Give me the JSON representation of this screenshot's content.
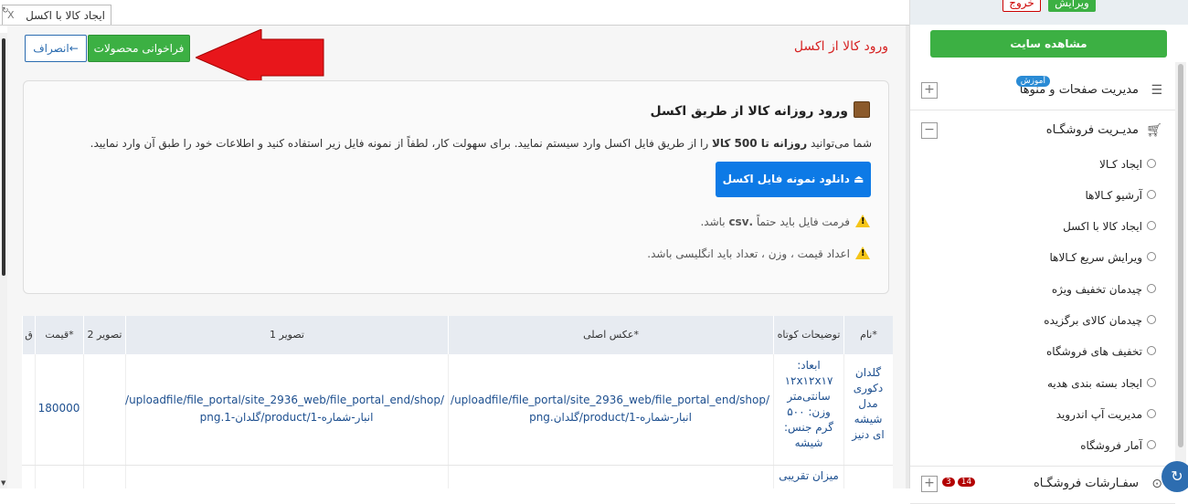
{
  "tab": {
    "title": "ایجاد کالا با اکسل",
    "close": "X"
  },
  "header": {
    "title": "ورود کالا از اکسل",
    "cancel_label": "انصراف←",
    "fetch_label": "فراخوانی محصولات"
  },
  "panel": {
    "title": "ورود روزانه کالا از طریق اکسل",
    "desc_prefix": "شما می‌توانید ",
    "desc_bold1": "روزانه تا 500 کالا",
    "desc_suffix": " را از طریق فایل اکسل وارد سیستم نمایید. برای سهولت کار، لطفاً از نمونه فایل زیر استفاده کنید و اطلاعات خود را طبق آن وارد نمایید.",
    "download_label": "دانلود نمونه فایل اکسل",
    "note1_prefix": "فرمت فایل باید حتماً ",
    "note1_bold": ".csv",
    "note1_suffix": " باشد.",
    "note2": "اعداد قیمت ، وزن ، تعداد باید انگلیسی باشد."
  },
  "table": {
    "headers": [
      "نام*",
      "توضیحات کوتاه",
      "عکس اصلی*",
      "تصویر 1",
      "تصویر 2",
      "قیمت*",
      "ق"
    ],
    "row1": {
      "name": "گلدان دکوری مدل شیشه ای دنیز",
      "desc": "ابعاد: ۱۲x۱۲x۱۷ سانتی‌متر وزن: ۵۰۰ گرم جنس: شیشه",
      "main_image": "/uploadfile/file_portal/site_2936_web/file_portal_end/shop/انبار-شماره-1/product/گلدان.png",
      "image1": "/uploadfile/file_portal/site_2936_web/file_portal_end/shop/انبار-شماره-1/product/گلدان-1.png",
      "image2": "",
      "price": "180000"
    },
    "row2": {
      "desc": "میزان تقریبی"
    }
  },
  "sidebar": {
    "edit_label": "ویرایش",
    "exit_label": "خروج",
    "site_label": "مشاهده سایت",
    "sections": [
      {
        "label": "مدیریت صفحات و منوها",
        "badge": "آموزش",
        "toggle": "+"
      },
      {
        "label": "مدیـریت فروشگـاه",
        "toggle": "−"
      },
      {
        "label": "سفـارشات فروشگـاه",
        "toggle": "+",
        "badge1": "14",
        "badge2": "3"
      }
    ],
    "shop_items": [
      "ایجاد کـالا",
      "آرشیو کـالاها",
      "ایجاد کالا با اکسل",
      "ویرایش سریع کـالاها",
      "چیدمان تخفیف ویژه",
      "چیدمان کالای برگزیده",
      "تخفیف های فروشگاه",
      "ایجاد بسته بندی هدیه",
      "مدیریت آپ اندروید",
      "آمار فروشگاه"
    ]
  },
  "colors": {
    "accent_green": "#3cb043",
    "accent_blue": "#0d7ae6",
    "title_red": "#d62222",
    "arrow_red": "#e8161b"
  }
}
